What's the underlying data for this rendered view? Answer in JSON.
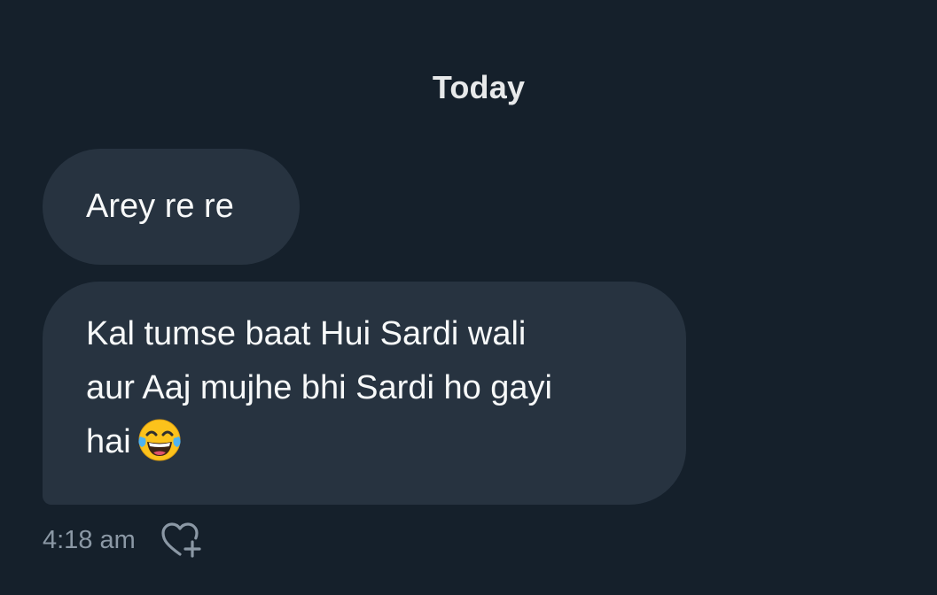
{
  "conversation": {
    "date_separator": "Today",
    "messages": [
      {
        "lines": [
          "Arey re re"
        ]
      },
      {
        "lines": [
          "Kal tumse baat Hui Sardi wali",
          "aur Aaj mujhe bhi Sardi ho gayi",
          "hai"
        ],
        "trailing_emoji": "face-with-tears-of-joy"
      }
    ],
    "timestamp": "4:18 am",
    "reaction_icon": "heart-plus-icon"
  },
  "colors": {
    "background": "#15202b",
    "bubble": "#273340",
    "text": "#f7f9f9",
    "muted": "#8b98a5"
  }
}
